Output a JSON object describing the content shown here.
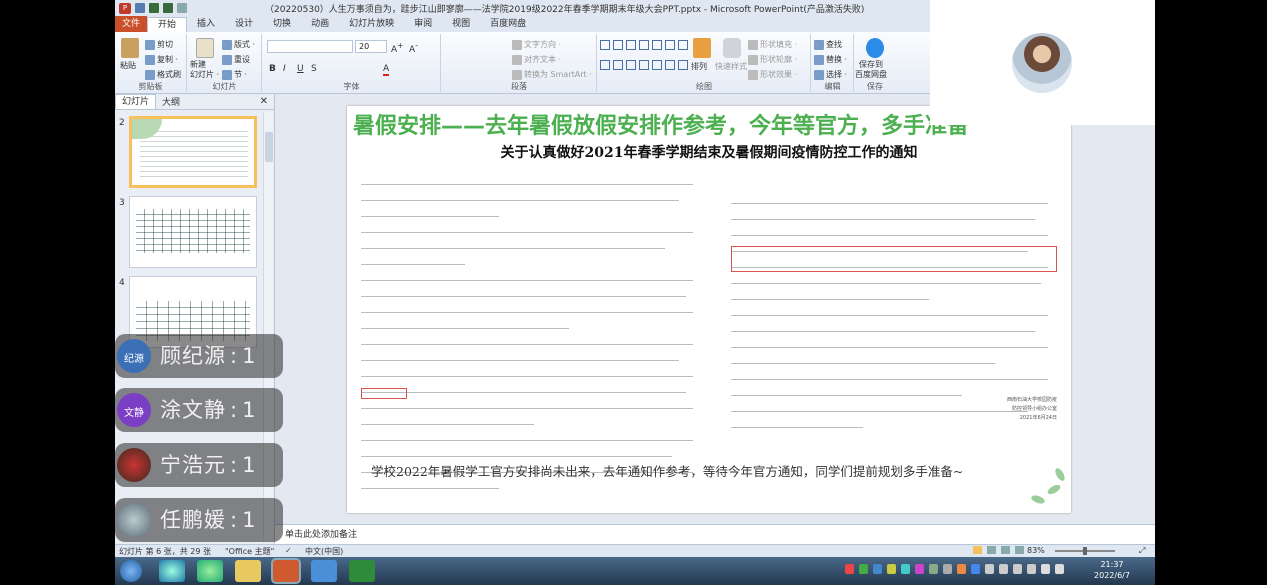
{
  "window": {
    "title": "（20220530）人生万事须自为，跬步江山即寥廓——法学院2019级2022年春季学期期末年级大会PPT.pptx - Microsoft PowerPoint(产品激活失败)"
  },
  "menu": {
    "file": "文件",
    "tabs": [
      "开始",
      "插入",
      "设计",
      "切换",
      "动画",
      "幻灯片放映",
      "审阅",
      "视图",
      "百度网盘"
    ]
  },
  "ribbon": {
    "clipboard": {
      "label": "剪贴板",
      "paste": "粘贴",
      "cut": "剪切",
      "copy": "复制 ·",
      "format_painter": "格式刷"
    },
    "slides": {
      "label": "幻灯片",
      "new_slide": "新建\n幻灯片 ·",
      "layout": "版式 ·",
      "reset": "重设",
      "section": "节 ·"
    },
    "font": {
      "label": "字体",
      "size": "20"
    },
    "paragraph": {
      "label": "段落",
      "text_direction": "文字方向 ·",
      "align_text": "对齐文本 ·",
      "smartart": "转换为 SmartArt ·"
    },
    "drawing": {
      "label": "绘图",
      "arrange": "排列",
      "quick_styles": "快速样式",
      "fill": "形状填充 ·",
      "outline": "形状轮廓 ·",
      "effects": "形状效果 ·"
    },
    "editing": {
      "label": "编辑",
      "find": "查找",
      "replace": "替换 ·",
      "select": "选择 ·"
    },
    "save": {
      "label": "保存",
      "button": "保存到\n百度网盘"
    }
  },
  "left_panel": {
    "tabs": [
      "幻灯片",
      "大纲"
    ],
    "close": "✕",
    "slides": [
      "2",
      "3",
      "4"
    ]
  },
  "slide": {
    "title": "暑假安排——去年暑假放假安排作参考，今年等官方，多手准备",
    "doc_title": "关于认真做好2021年春季学期结束及暑假期间疫情防控工作的通知",
    "caption": "学校2022年暑假学工官方安排尚未出来，去年通知作参考，等待今年官方通知，同学们提前规划多手准备~",
    "sign_org": "西南石油大学校园防疫",
    "sign_office": "防控领导小组办公室",
    "sign_date": "2021年6月24日"
  },
  "notes": {
    "placeholder": "单击此处添加备注"
  },
  "status_bar": {
    "slide_info": "幻灯片 第 6 张，共 29 张",
    "theme": "\"Office 主题\"",
    "language": "中文(中国)",
    "zoom": "83%"
  },
  "participants": [
    {
      "name": "顾纪源",
      "avatar_text": "纪源",
      "count": "1",
      "color": "#3b6fb6"
    },
    {
      "name": "涂文静",
      "avatar_text": "文静",
      "count": "1",
      "color": "#7b3fc4"
    },
    {
      "name": "宁浩元",
      "avatar_text": "",
      "count": "1",
      "color": "#3a2a1e"
    },
    {
      "name": "任鹏媛",
      "avatar_text": "",
      "count": "1",
      "color": "#5a6a7a"
    }
  ],
  "taskbar": {
    "time": "21:37",
    "date": "2022/6/7"
  }
}
